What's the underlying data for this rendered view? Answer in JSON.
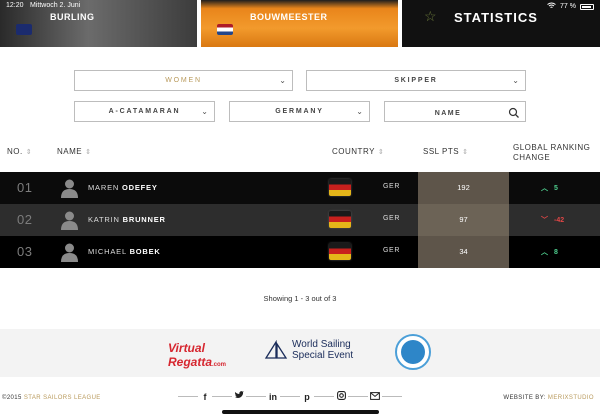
{
  "status_bar": {
    "time": "12:20",
    "date": "Mittwoch 2. Juni",
    "battery": "77 %"
  },
  "hero": {
    "cards": [
      {
        "name": "BURLING",
        "flag": "nz"
      },
      {
        "name": "BOUWMEESTER",
        "flag": "nl"
      },
      {
        "name": "STATISTICS"
      }
    ]
  },
  "filters": {
    "gender": "WOMEN",
    "role": "SKIPPER",
    "boat_class": "A-CATAMARAN",
    "country": "GERMANY",
    "search_placeholder": "NAME"
  },
  "table": {
    "headers": {
      "no": "NO.",
      "name": "NAME",
      "country": "COUNTRY",
      "ssl": "SSL PTS",
      "global_line1": "GLOBAL RANKING",
      "global_line2": "CHANGE"
    },
    "rows": [
      {
        "rank": "01",
        "first": "MAREN",
        "last": "ODEFEY",
        "country": "GER",
        "ssl": "192",
        "change": "5",
        "direction": "up"
      },
      {
        "rank": "02",
        "first": "KATRIN",
        "last": "BRUNNER",
        "country": "GER",
        "ssl": "97",
        "change": "-42",
        "direction": "down"
      },
      {
        "rank": "03",
        "first": "MICHAEL",
        "last": "BOBEK",
        "country": "GER",
        "ssl": "34",
        "change": "8",
        "direction": "up"
      }
    ]
  },
  "showing": "Showing 1 - 3 out of 3",
  "sponsors": {
    "virtual_regatta_a": "Virtual",
    "virtual_regatta_b": "Regatta",
    "virtual_regatta_c": ".com",
    "world_sailing_1": "World Sailing",
    "world_sailing_2": "Special Event"
  },
  "footer": {
    "copyright_year": "©2015",
    "copyright_org": "STAR SAILORS LEAGUE",
    "credit_label": "WEBSITE BY:",
    "credit_name": "MERIXSTUDIO"
  },
  "colors": {
    "accent_gold": "#b99a5c",
    "up": "#4fd08f",
    "down": "#e04646"
  }
}
